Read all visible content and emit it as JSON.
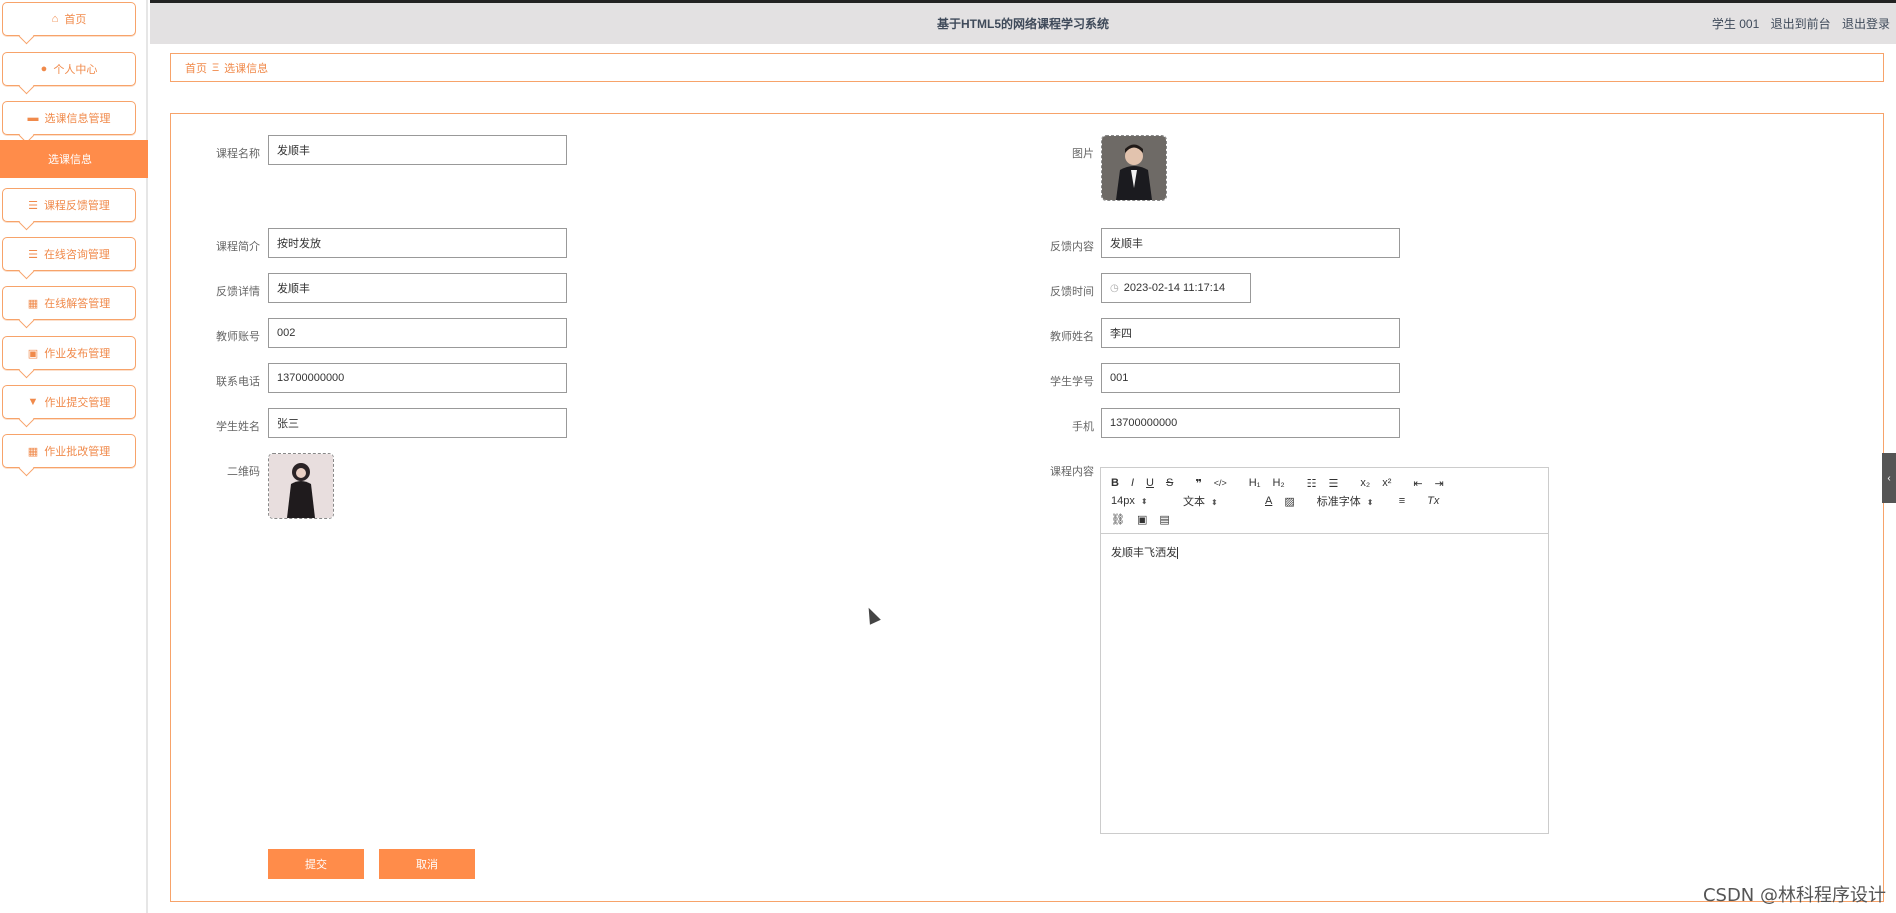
{
  "header": {
    "title": "基于HTML5的网络课程学习系统",
    "user": "学生 001",
    "front_link": "退出到前台",
    "logout_link": "退出登录"
  },
  "sidebar": {
    "items": [
      {
        "label": "首页",
        "icon": "home-icon"
      },
      {
        "label": "个人中心",
        "icon": "user-icon"
      },
      {
        "label": "选课信息管理",
        "icon": "chat-icon"
      },
      {
        "label": "课程反馈管理",
        "icon": "list-icon"
      },
      {
        "label": "在线咨询管理",
        "icon": "list-icon"
      },
      {
        "label": "在线解答管理",
        "icon": "grid-icon"
      },
      {
        "label": "作业发布管理",
        "icon": "clipboard-icon"
      },
      {
        "label": "作业提交管理",
        "icon": "trophy-icon"
      },
      {
        "label": "作业批改管理",
        "icon": "grid-icon"
      }
    ],
    "active_sub": "选课信息"
  },
  "breadcrumb": {
    "home": "首页",
    "separator": "Ξ",
    "current": "选课信息"
  },
  "form": {
    "course_name": {
      "label": "课程名称",
      "value": "发顺丰"
    },
    "image": {
      "label": "图片"
    },
    "course_intro": {
      "label": "课程简介",
      "value": "按时发放"
    },
    "feedback_content": {
      "label": "反馈内容",
      "value": "发顺丰"
    },
    "feedback_detail": {
      "label": "反馈详情",
      "value": "发顺丰"
    },
    "feedback_time": {
      "label": "反馈时间",
      "value": "2023-02-14 11:17:14"
    },
    "teacher_account": {
      "label": "教师账号",
      "value": "002"
    },
    "teacher_name": {
      "label": "教师姓名",
      "value": "李四"
    },
    "phone": {
      "label": "联系电话",
      "value": "13700000000"
    },
    "student_id": {
      "label": "学生学号",
      "value": "001"
    },
    "student_name": {
      "label": "学生姓名",
      "value": "张三"
    },
    "mobile": {
      "label": "手机",
      "value": "13700000000"
    },
    "qrcode": {
      "label": "二维码"
    },
    "course_content": {
      "label": "课程内容",
      "text": "发顺丰飞洒发",
      "font_size": "14px",
      "para_type": "文本",
      "font_family": "标准字体"
    }
  },
  "buttons": {
    "submit": "提交",
    "cancel": "取消"
  },
  "watermark": "CSDN @林科程序设计",
  "colors": {
    "accent": "#ff8c4a",
    "border": "#f7a36a"
  }
}
